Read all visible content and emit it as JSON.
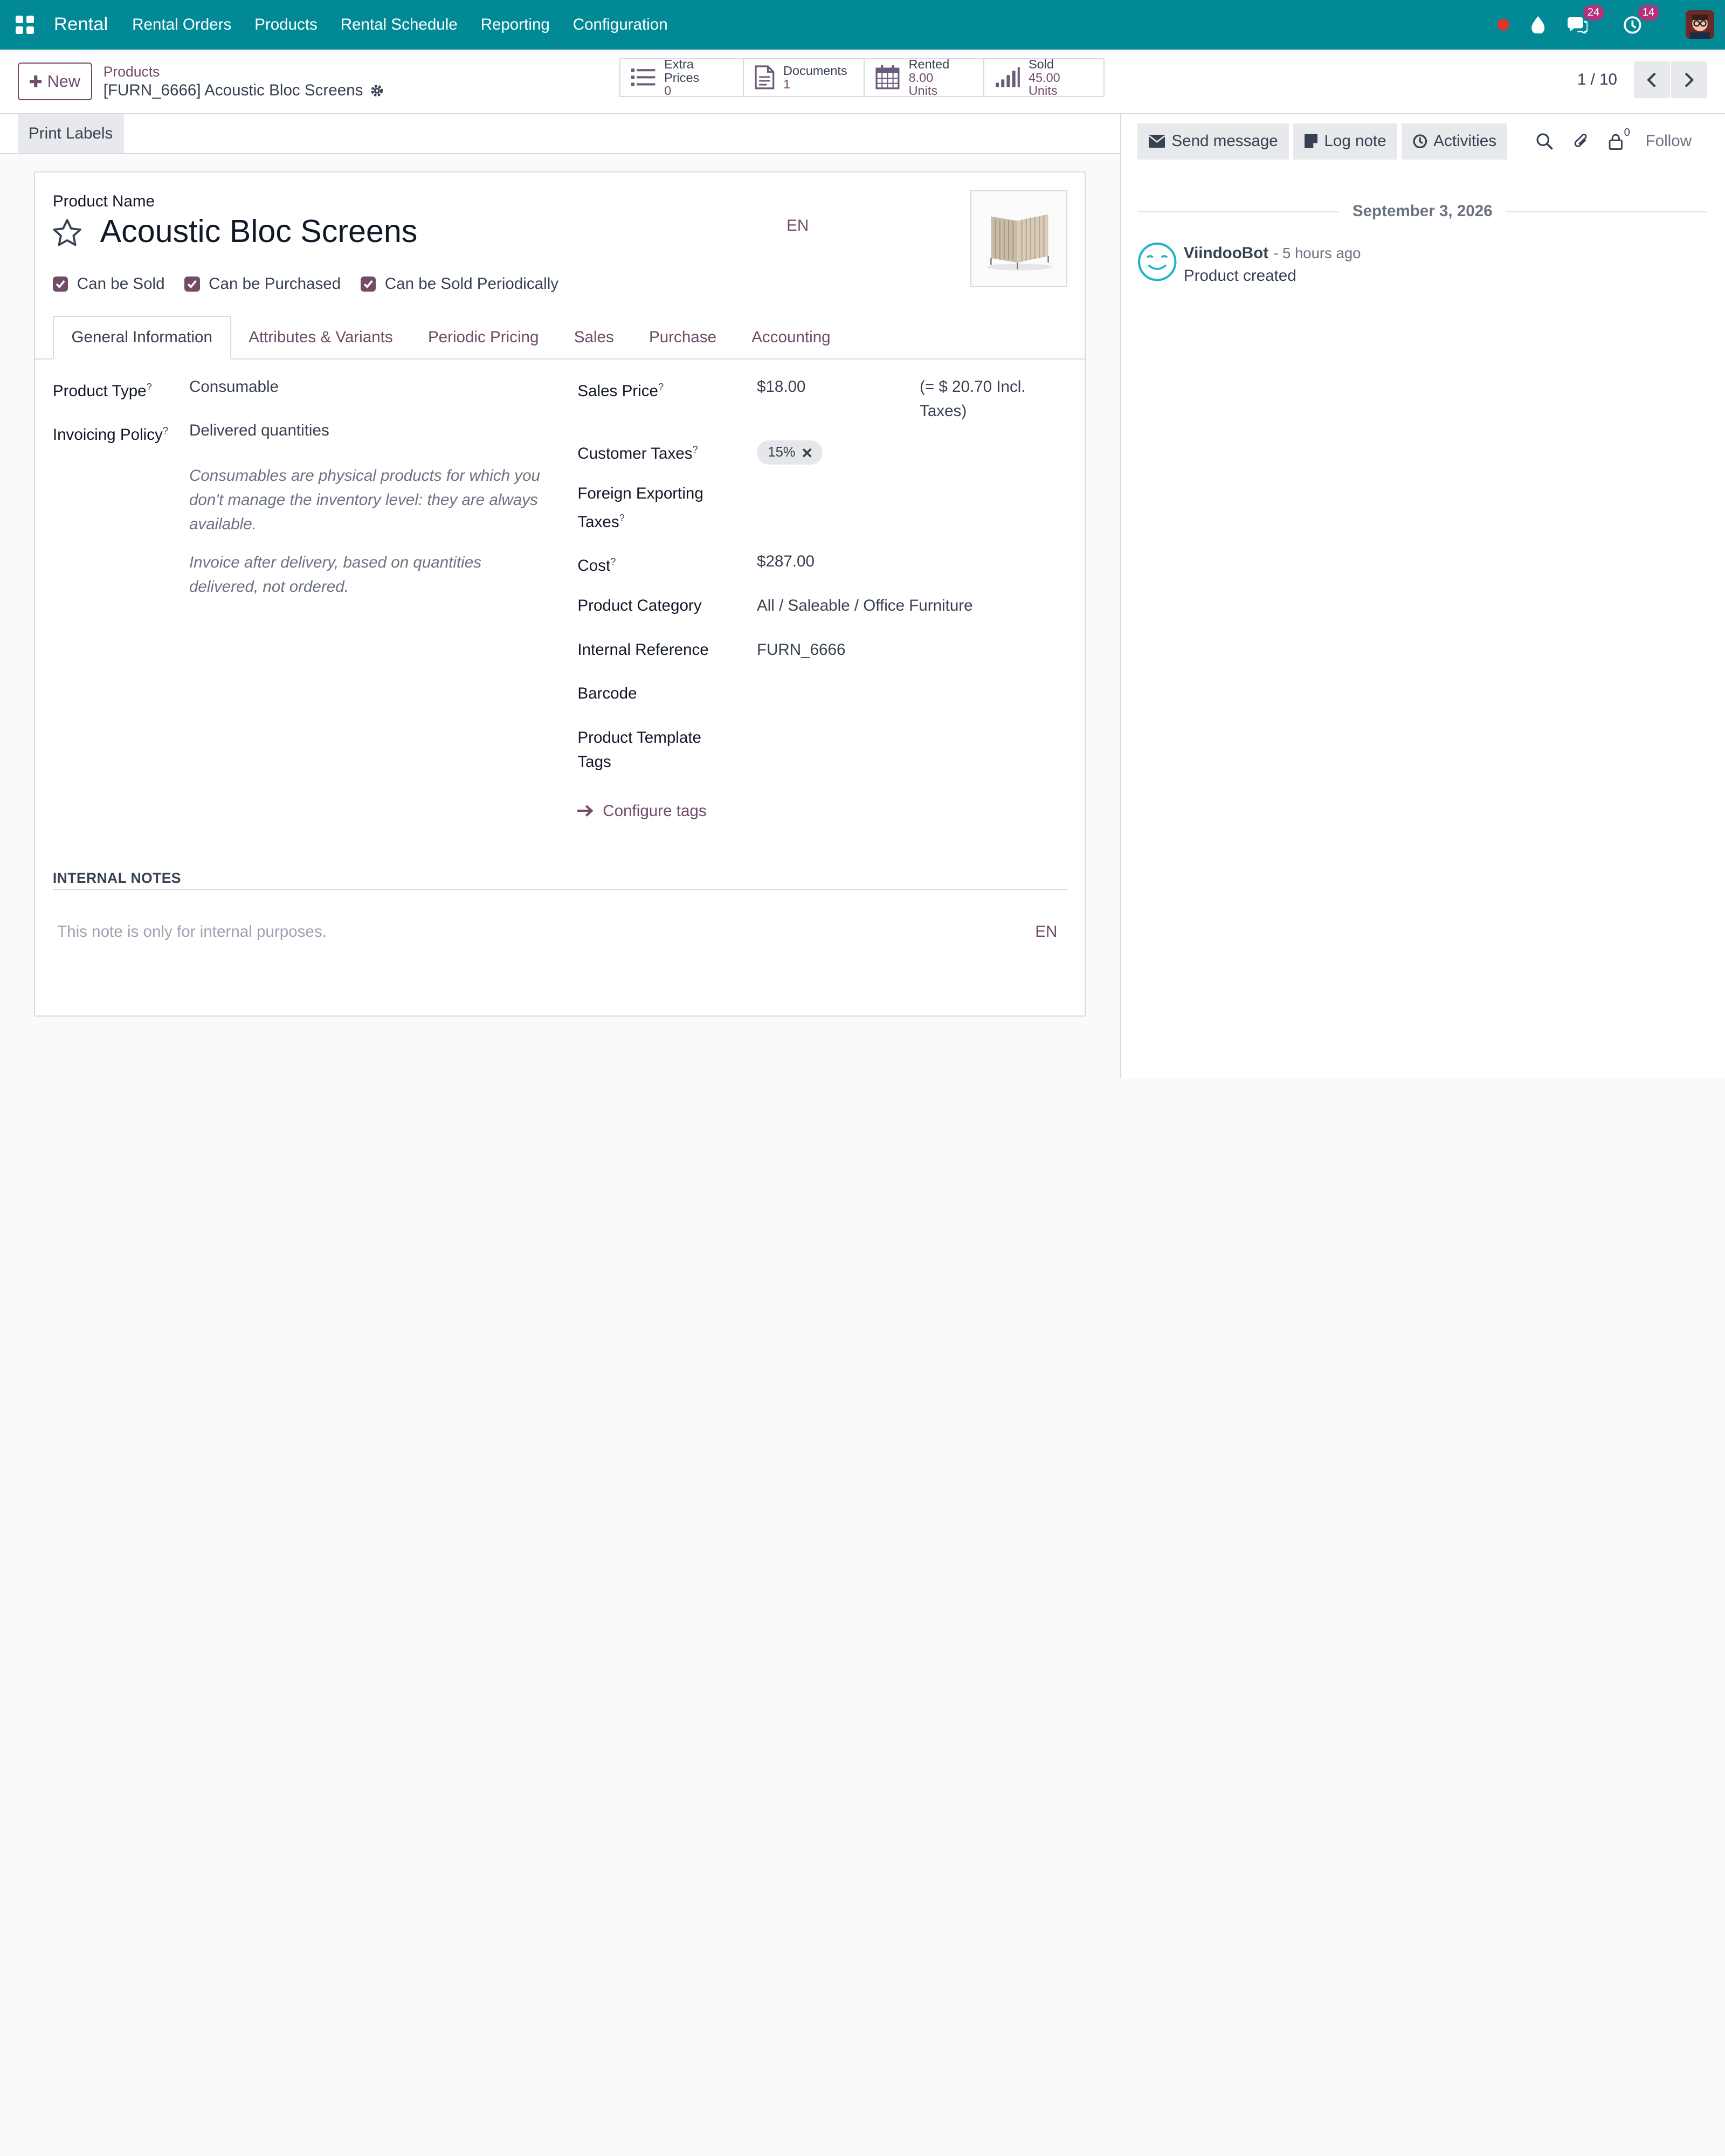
{
  "navbar": {
    "brand": "Rental",
    "menu": [
      "Rental Orders",
      "Products",
      "Rental Schedule",
      "Reporting",
      "Configuration"
    ],
    "messages_count": "24",
    "activities_count": "14",
    "color": "#018a96"
  },
  "control": {
    "new_label": "New",
    "breadcrumb_parent": "Products",
    "breadcrumb_current": "[FURN_6666] Acoustic Bloc Screens",
    "pager": "1 / 10",
    "smart_buttons": [
      {
        "label": "Extra Prices",
        "value": "0",
        "icon": "list-icon"
      },
      {
        "label": "Documents",
        "value": "1",
        "icon": "document-icon"
      },
      {
        "label": "Rented",
        "value": "8.00",
        "unit": "Units",
        "icon": "calendar-icon"
      },
      {
        "label": "Sold",
        "value": "45.00 Units",
        "icon": "bar-chart-icon"
      }
    ]
  },
  "statusbar": {
    "print_labels": "Print Labels"
  },
  "form": {
    "name_label": "Product Name",
    "name": "Acoustic Bloc Screens",
    "lang": "EN",
    "checkboxes": [
      "Can be Sold",
      "Can be Purchased",
      "Can be Sold Periodically"
    ],
    "tabs": [
      "General Information",
      "Attributes & Variants",
      "Periodic Pricing",
      "Sales",
      "Purchase",
      "Accounting"
    ],
    "left": {
      "product_type_label": "Product Type",
      "product_type": "Consumable",
      "invoicing_policy_label": "Invoicing Policy",
      "invoicing_policy": "Delivered quantities",
      "hint1": "Consumables are physical products for which you don't manage the inventory level: they are always available.",
      "hint2": "Invoice after delivery, based on quantities delivered, not ordered."
    },
    "right": {
      "sales_price_label": "Sales Price",
      "sales_price": "$18.00",
      "incl_taxes": "(= $ 20.70 Incl. Taxes)",
      "customer_taxes_label": "Customer Taxes",
      "customer_taxes": "15%",
      "foreign_taxes_label_1": "Foreign Exporting",
      "foreign_taxes_label_2": "Taxes",
      "cost_label": "Cost",
      "cost": "$287.00",
      "category_label": "Product Category",
      "category": "All / Saleable / Office Furniture",
      "internal_ref_label": "Internal Reference",
      "internal_ref": "FURN_6666",
      "barcode_label": "Barcode",
      "tags_label_1": "Product Template",
      "tags_label_2": "Tags",
      "configure_tags": "Configure tags"
    },
    "notes_title": "INTERNAL NOTES",
    "notes_placeholder": "This note is only for internal purposes.",
    "notes_lang": "EN"
  },
  "chatter": {
    "send_message": "Send message",
    "log_note": "Log note",
    "activities": "Activities",
    "followers_count": "0",
    "follow": "Follow",
    "date": "September 3, 2026",
    "author": "ViindooBot",
    "time": "- 5 hours ago",
    "body": "Product created"
  },
  "colors": {
    "accent": "#714b67",
    "navbar": "#018a96",
    "badge": "#b3317d"
  }
}
